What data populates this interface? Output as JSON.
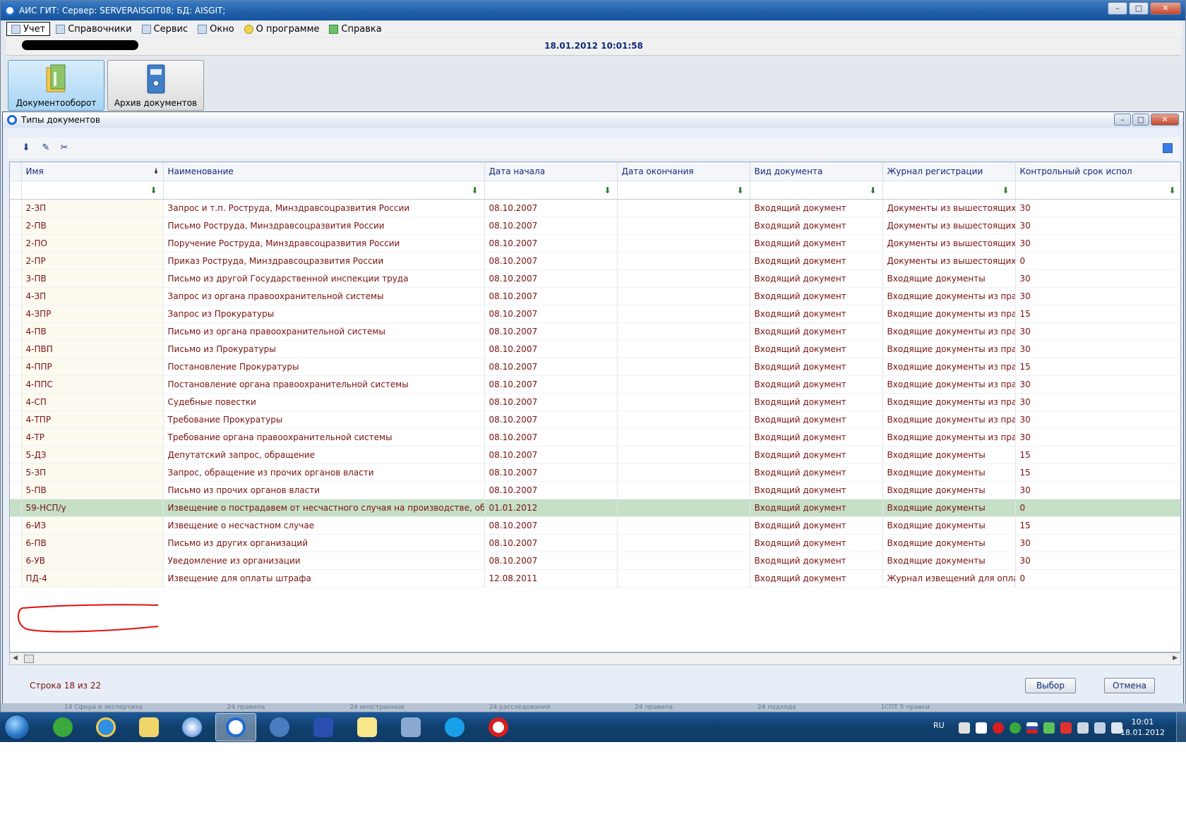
{
  "app": {
    "title": "АИС ГИТ:  Сервер: SERVERAISGIT08;   БД: AISGIT;",
    "window_buttons": {
      "minimize": "–",
      "maximize": "□",
      "close": "✕"
    }
  },
  "menu": [
    {
      "label": "Учет",
      "icon": "table-icon"
    },
    {
      "label": "Справочники",
      "icon": "books-icon"
    },
    {
      "label": "Сервис",
      "icon": "home-icon"
    },
    {
      "label": "Окно",
      "icon": "windows-icon"
    },
    {
      "label": "О программе",
      "icon": "smiley-icon"
    },
    {
      "label": "Справка",
      "icon": "help-book-icon"
    }
  ],
  "infobar": {
    "datetime": "18.01.2012  10:01:58"
  },
  "modules": [
    {
      "label": "Документооборот",
      "icon": "folder-icon"
    },
    {
      "label": "Архив документов",
      "icon": "binder-icon"
    }
  ],
  "dialog": {
    "title": "Типы документов",
    "toolbar": [
      {
        "icon": "save-icon",
        "glyph": "⬇"
      },
      {
        "icon": "edit-icon",
        "glyph": "✎"
      },
      {
        "icon": "scissors-icon",
        "glyph": "✂"
      }
    ],
    "columns": [
      "Имя",
      "Наименование",
      "Дата начала",
      "Дата окончания",
      "Вид документа",
      "Журнал регистрации",
      "Контрольный срок испол"
    ],
    "rows": [
      [
        "2-ЗП",
        "Запрос и т.п. Роструда, Минздравсоцразвития России",
        "08.10.2007",
        "",
        "Входящий документ",
        "Документы из вышестоящих ор",
        "30"
      ],
      [
        "2-ПВ",
        "Письмо Роструда, Минздравсоцразвития России",
        "08.10.2007",
        "",
        "Входящий документ",
        "Документы из вышестоящих ор",
        "30"
      ],
      [
        "2-ПО",
        "Поручение Роструда, Минздравсоцразвития России",
        "08.10.2007",
        "",
        "Входящий документ",
        "Документы из вышестоящих ор",
        "30"
      ],
      [
        "2-ПР",
        "Приказ Роструда, Минздравсоцразвития России",
        "08.10.2007",
        "",
        "Входящий документ",
        "Документы из вышестоящих ор",
        "0"
      ],
      [
        "3-ПВ",
        "Письмо из другой Государственной инспекции труда",
        "08.10.2007",
        "",
        "Входящий документ",
        "Входящие документы",
        "30"
      ],
      [
        "4-ЗП",
        "Запрос из органа правоохранительной системы",
        "08.10.2007",
        "",
        "Входящий документ",
        "Входящие документы из правоо",
        "30"
      ],
      [
        "4-ЗПР",
        "Запрос из Прокуратуры",
        "08.10.2007",
        "",
        "Входящий документ",
        "Входящие документы из правоо",
        "15"
      ],
      [
        "4-ПВ",
        "Письмо из органа правоохранительной системы",
        "08.10.2007",
        "",
        "Входящий документ",
        "Входящие документы из правоо",
        "30"
      ],
      [
        "4-ПВП",
        "Письмо из Прокуратуры",
        "08.10.2007",
        "",
        "Входящий документ",
        "Входящие документы из правоо",
        "30"
      ],
      [
        "4-ППР",
        "Постановление Прокуратуры",
        "08.10.2007",
        "",
        "Входящий документ",
        "Входящие документы из правоо",
        "15"
      ],
      [
        "4-ППС",
        "Постановление органа правоохранительной системы",
        "08.10.2007",
        "",
        "Входящий документ",
        "Входящие документы из правоо",
        "30"
      ],
      [
        "4-СП",
        "Судебные повестки",
        "08.10.2007",
        "",
        "Входящий документ",
        "Входящие документы из правоо",
        "30"
      ],
      [
        "4-ТПР",
        "Требование Прокуратуры",
        "08.10.2007",
        "",
        "Входящий документ",
        "Входящие документы из правоо",
        "30"
      ],
      [
        "4-ТР",
        "Требование органа правоохранительной системы",
        "08.10.2007",
        "",
        "Входящий документ",
        "Входящие документы из правоо",
        "30"
      ],
      [
        "5-ДЗ",
        "Депутатский запрос, обращение",
        "08.10.2007",
        "",
        "Входящий документ",
        "Входящие документы",
        "15"
      ],
      [
        "5-ЗП",
        "Запрос, обращение из прочих органов власти",
        "08.10.2007",
        "",
        "Входящий документ",
        "Входящие документы",
        "15"
      ],
      [
        "5-ПВ",
        "Письмо из прочих органов власти",
        "08.10.2007",
        "",
        "Входящий документ",
        "Входящие документы",
        "30"
      ],
      [
        "59-НСП/у",
        "Извещение о пострадавем от несчастного случая на производстве, обратившем",
        "01.01.2012",
        "",
        "Входящий документ",
        "Входящие документы",
        "0"
      ],
      [
        "6-ИЗ",
        "Извещение о несчастном случае",
        "08.10.2007",
        "",
        "Входящий документ",
        "Входящие документы",
        "15"
      ],
      [
        "6-ПВ",
        "Письмо из других организаций",
        "08.10.2007",
        "",
        "Входящий документ",
        "Входящие документы",
        "30"
      ],
      [
        "6-УВ",
        "Уведомление из организации",
        "08.10.2007",
        "",
        "Входящий документ",
        "Входящие документы",
        "30"
      ],
      [
        "ПД-4",
        "Извещение для оплаты штрафа",
        "12.08.2011",
        "",
        "Входящий документ",
        "Журнал извещений для оплаты",
        "0"
      ]
    ],
    "selected_row": 17,
    "status": "Строка 18 из 22",
    "buttons": {
      "select": "Выбор",
      "cancel": "Отмена"
    }
  },
  "background_strip": [
    "14 Сфера и экспертиза",
    "24 правила",
    "24 иностранные",
    "24 расследования",
    "24 правила",
    "24 подхода",
    "1СПТ 5 правки"
  ],
  "taskbar": {
    "apps": [
      "start-orb",
      "clover-icon",
      "ie-icon",
      "explorer-icon",
      "browser-icon",
      "aisgit-icon",
      "thunderbird-icon",
      "save-disk-icon",
      "notes-icon",
      "network-icon",
      "skype-icon",
      "opera-icon"
    ],
    "active_app": 5,
    "lang": "RU",
    "tray_icons": [
      "tray-a",
      "tray-b",
      "tray-opera",
      "tray-c",
      "tray-flag",
      "tray-d",
      "tray-k",
      "tray-e",
      "tray-network",
      "tray-volume"
    ],
    "clock_time": "10:01",
    "clock_date": "18.01.2012"
  },
  "colors": {
    "titlebar": "#1f5fa8",
    "header_text": "#102a7a",
    "cell_text": "#7a1010",
    "selected_row": "#c6e0c7",
    "annotation": "#e01010"
  }
}
